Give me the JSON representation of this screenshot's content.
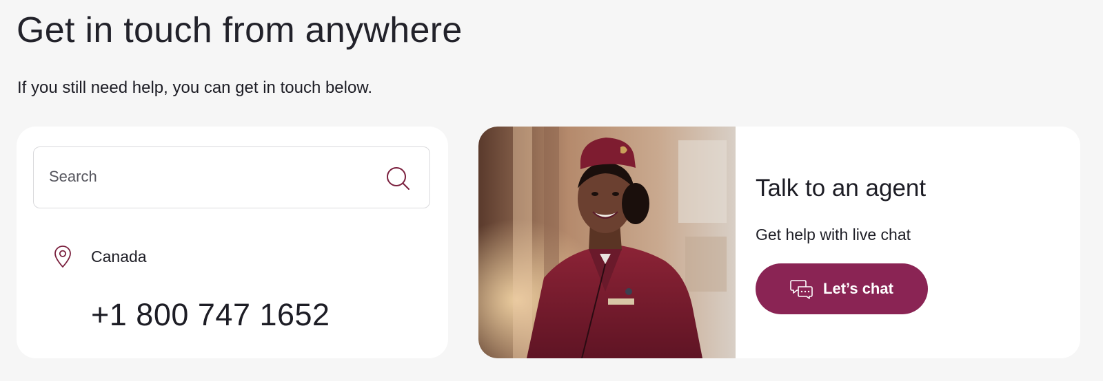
{
  "header": {
    "title": "Get in touch from anywhere",
    "subtitle": "If you still need help, you can get in touch below."
  },
  "contact_card": {
    "search": {
      "placeholder": "Search",
      "value": "",
      "icon": "search-icon"
    },
    "location": {
      "icon": "location-pin-icon",
      "label": "Canada"
    },
    "phone": "+1 800 747 1652"
  },
  "agent_card": {
    "photo": "flight-attendant-photo",
    "title": "Talk to an agent",
    "description": "Get help with live chat",
    "chat_button": {
      "icon": "chat-bubbles-icon",
      "label": "Let’s chat"
    }
  },
  "colors": {
    "background": "#f6f6f6",
    "card": "#ffffff",
    "accent": "#8a2454",
    "icon_accent": "#7a1f3d",
    "text": "#1d1d25"
  }
}
